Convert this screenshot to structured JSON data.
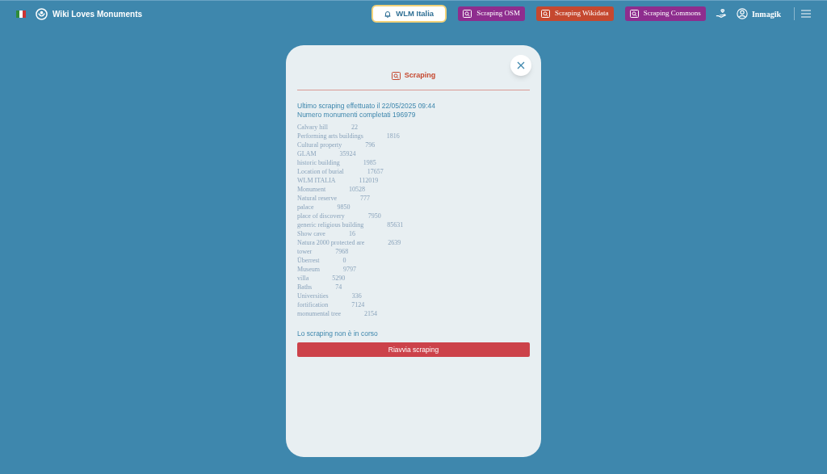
{
  "navbar": {
    "brand": "Wiki Loves Monuments",
    "links": [
      {
        "label": "WLM Italia",
        "kind": "outline",
        "color": "#ffffff"
      },
      {
        "label": "Scraping OSM",
        "kind": "scraping",
        "color": "#8e2d8e"
      },
      {
        "label": "Scraping Wikidata",
        "kind": "scraping",
        "color": "#c5482f"
      },
      {
        "label": "Scraping Commons",
        "kind": "scraping",
        "color": "#8e2d8e"
      }
    ],
    "user": "Inmagik"
  },
  "modal": {
    "title": "Scraping",
    "info": [
      "Ultimo scraping effettuato il 22/05/2025 09:44",
      "Numero monumenti completati 196979"
    ],
    "rows": [
      {
        "label": "Calvary hill",
        "value": "22"
      },
      {
        "label": "Performing arts buildings",
        "value": "1816"
      },
      {
        "label": "Cultural property",
        "value": "796"
      },
      {
        "label": "GLAM",
        "value": "35924"
      },
      {
        "label": "historic building",
        "value": "1985"
      },
      {
        "label": "Location of burial",
        "value": "17657"
      },
      {
        "label": "WLM ITALIA",
        "value": "112019"
      },
      {
        "label": "Monument",
        "value": "10528"
      },
      {
        "label": "Natural reserve",
        "value": "777"
      },
      {
        "label": "palace",
        "value": "9850"
      },
      {
        "label": "place of discovery",
        "value": "7950"
      },
      {
        "label": "generic religious building",
        "value": "85631"
      },
      {
        "label": "Show cave",
        "value": "16"
      },
      {
        "label": "Natura 2000 protected are",
        "value": "2639"
      },
      {
        "label": "tower",
        "value": "7968"
      },
      {
        "label": "Überrest",
        "value": "0"
      },
      {
        "label": "Museum",
        "value": "9797"
      },
      {
        "label": "villa",
        "value": "5290"
      },
      {
        "label": "Baths",
        "value": "74"
      },
      {
        "label": "Universities",
        "value": "336"
      },
      {
        "label": "fortification",
        "value": "7124"
      },
      {
        "label": "monumental tree",
        "value": "2154"
      }
    ],
    "status": "Lo scraping non è in corso",
    "button": "Riavvia scraping"
  }
}
